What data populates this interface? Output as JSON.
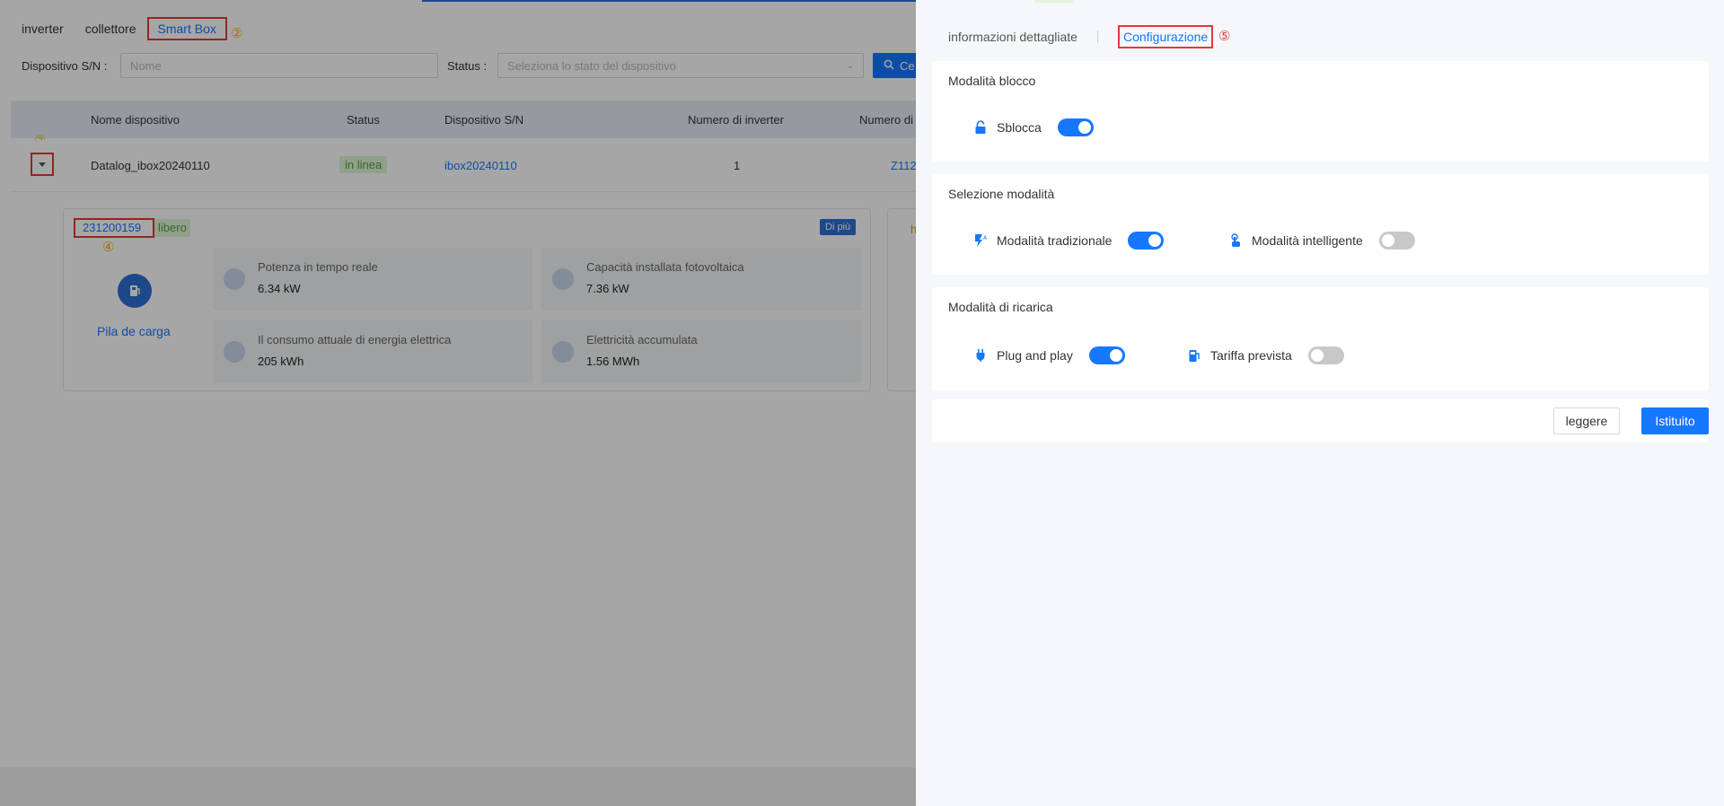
{
  "tabs": [
    "inverter",
    "collettore",
    "Smart Box"
  ],
  "markers": {
    "m2": "②",
    "m3": "③",
    "m4": "④",
    "m5": "⑤"
  },
  "filters": {
    "sn_label": "Dispositivo S/N :",
    "sn_placeholder": "Nome",
    "status_label": "Status :",
    "status_placeholder": "Seleziona lo stato del dispositivo",
    "search_label": "Ce"
  },
  "table": {
    "columns": [
      "Nome dispositivo",
      "Status",
      "Dispositivo S/N",
      "Numero di inverter",
      "Numero di"
    ],
    "row": {
      "name": "Datalog_ibox20240110",
      "status": "in linea",
      "sn": "ibox20240110",
      "inverter_count": "1",
      "extra": "Z112"
    }
  },
  "device": {
    "serial": "231200159",
    "state": "libero",
    "more": "Di più",
    "type_label": "Pila de carga",
    "card2_text": "h",
    "metrics": [
      {
        "label": "Potenza in tempo reale",
        "value": "6.34 kW"
      },
      {
        "label": "Capacità installata fotovoltaica",
        "value": "7.36 kW"
      },
      {
        "label": "Il consumo attuale di energia elettrica",
        "value": "205 kWh"
      },
      {
        "label": "Elettricità accumulata",
        "value": "1.56 MWh"
      }
    ]
  },
  "drawer": {
    "tabs": [
      "informazioni dettagliate",
      "Configurazione"
    ],
    "sections": {
      "lock": {
        "title": "Modalità blocco",
        "unlock_label": "Sblocca",
        "unlock_on": true
      },
      "mode": {
        "title": "Selezione modalità",
        "traditional_label": "Modalità tradizionale",
        "traditional_on": true,
        "smart_label": "Modalità intelligente",
        "smart_on": false
      },
      "charge": {
        "title": "Modalità di ricarica",
        "plug_label": "Plug and play",
        "plug_on": true,
        "tariff_label": "Tariffa prevista",
        "tariff_on": false
      }
    },
    "buttons": {
      "read": "leggere",
      "set": "Istituito"
    }
  },
  "colors": {
    "accent": "#1677ff",
    "highlight": "#e53935",
    "marker": "#f5b400",
    "success": "#52a33a"
  }
}
